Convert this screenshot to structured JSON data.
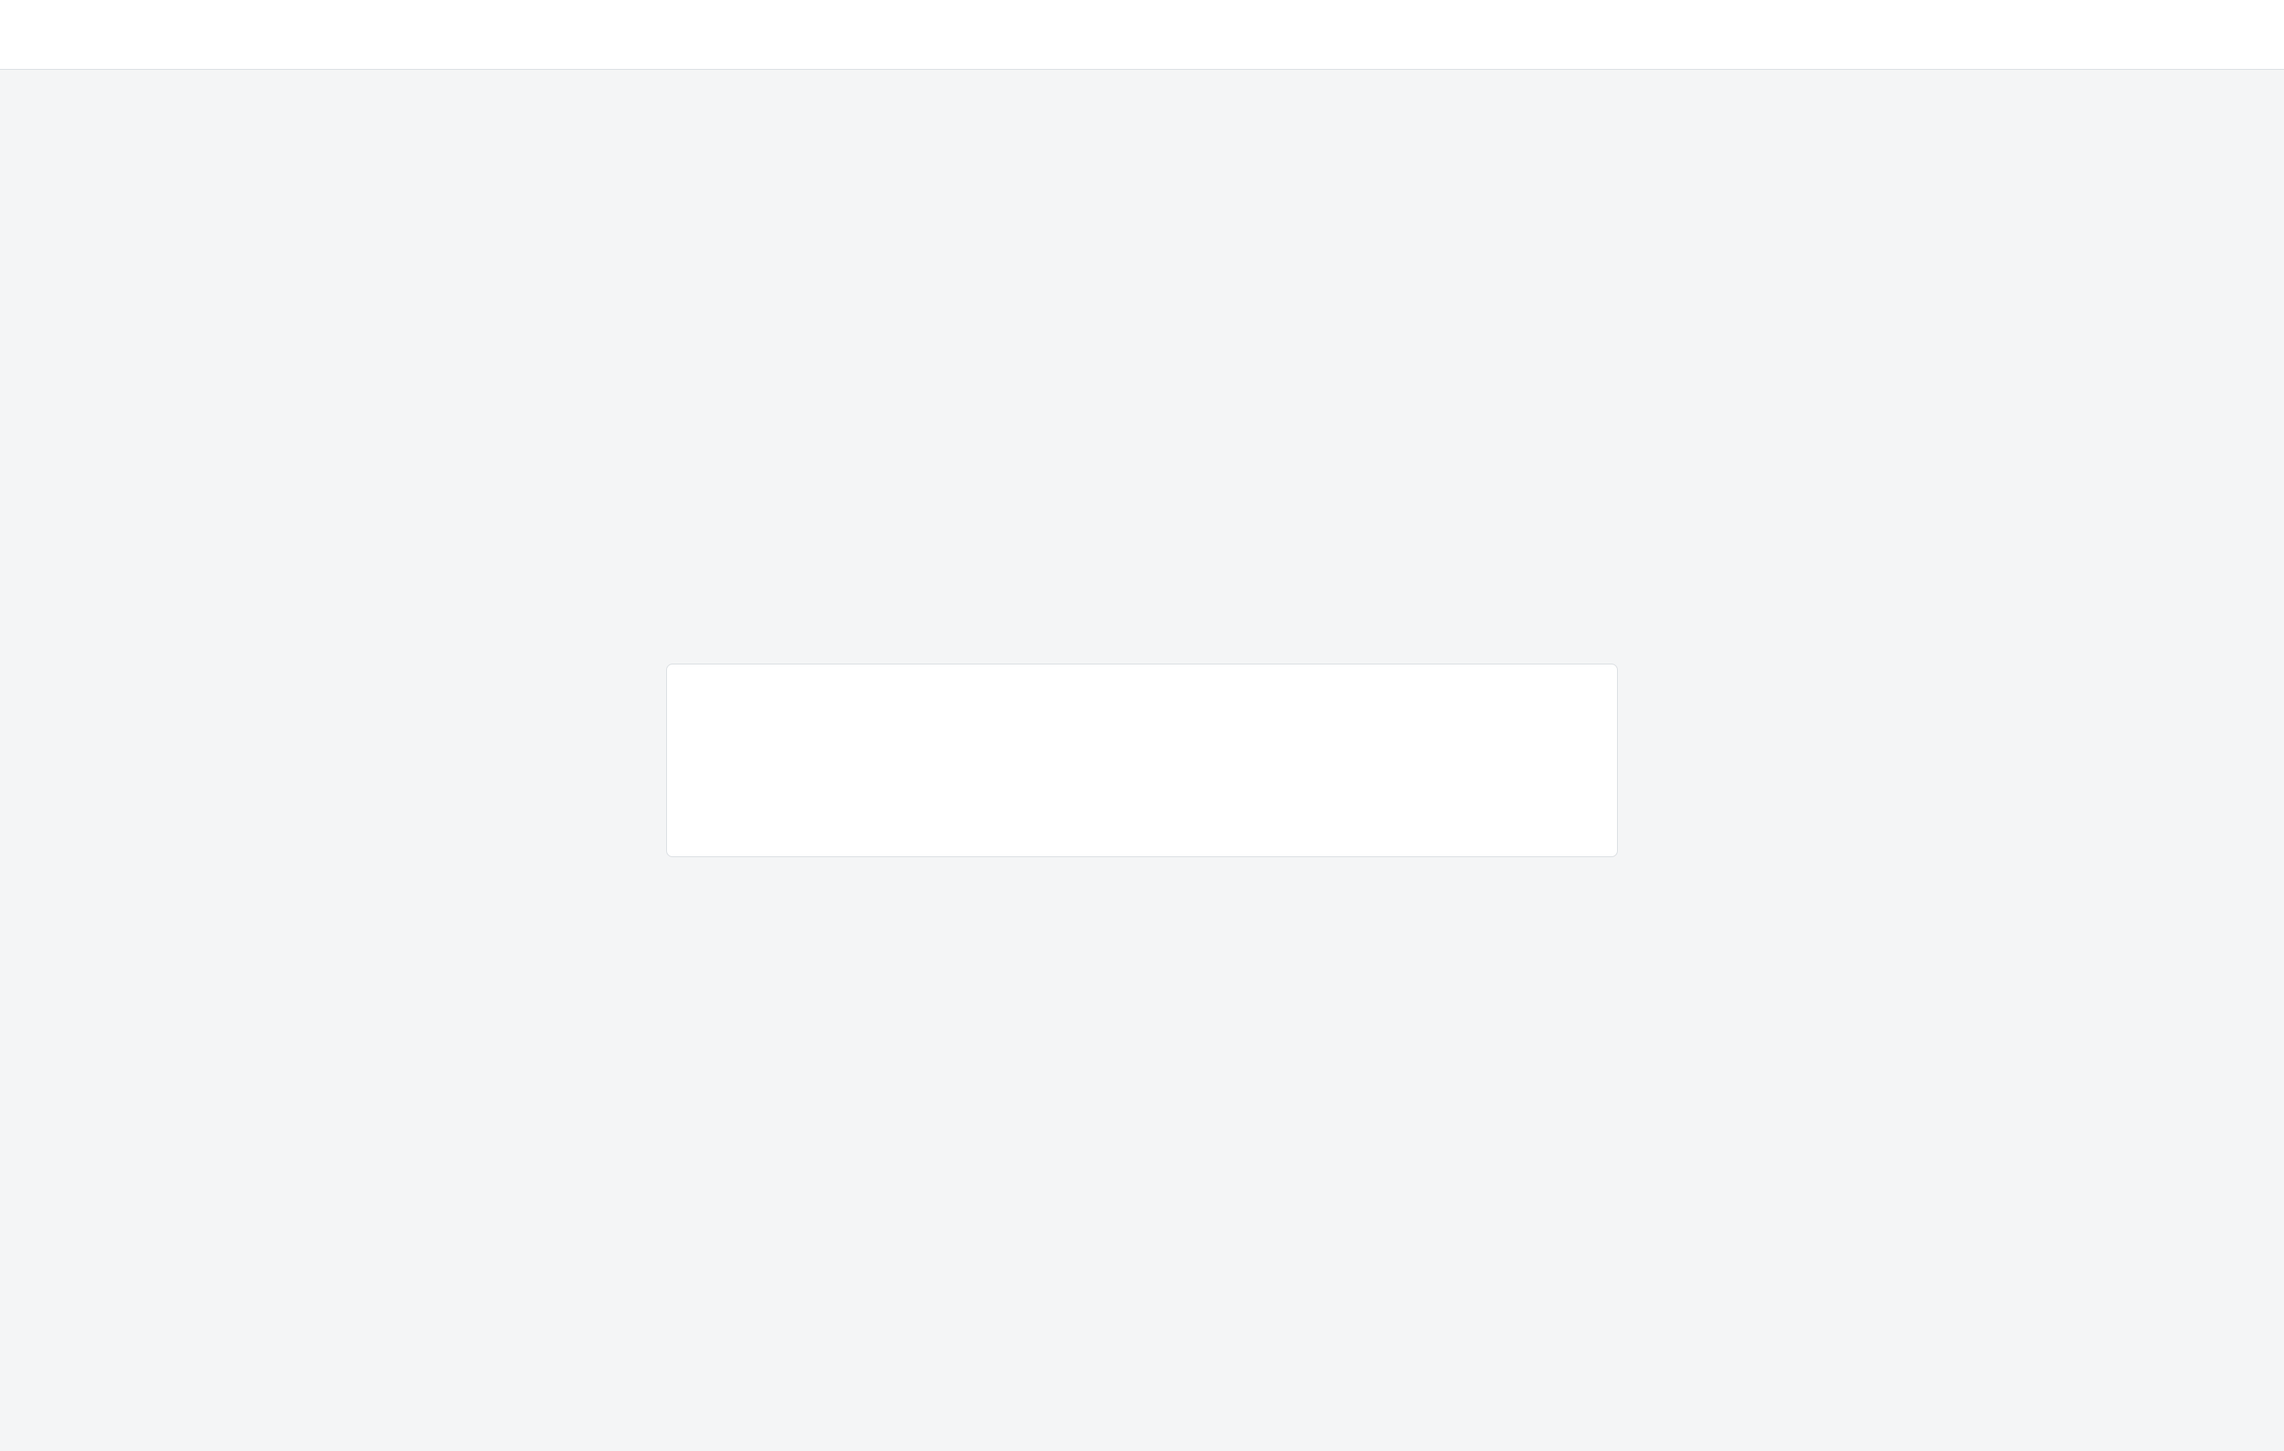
{
  "window": {
    "title": ""
  },
  "main": {
    "heading": "",
    "body": ""
  }
}
